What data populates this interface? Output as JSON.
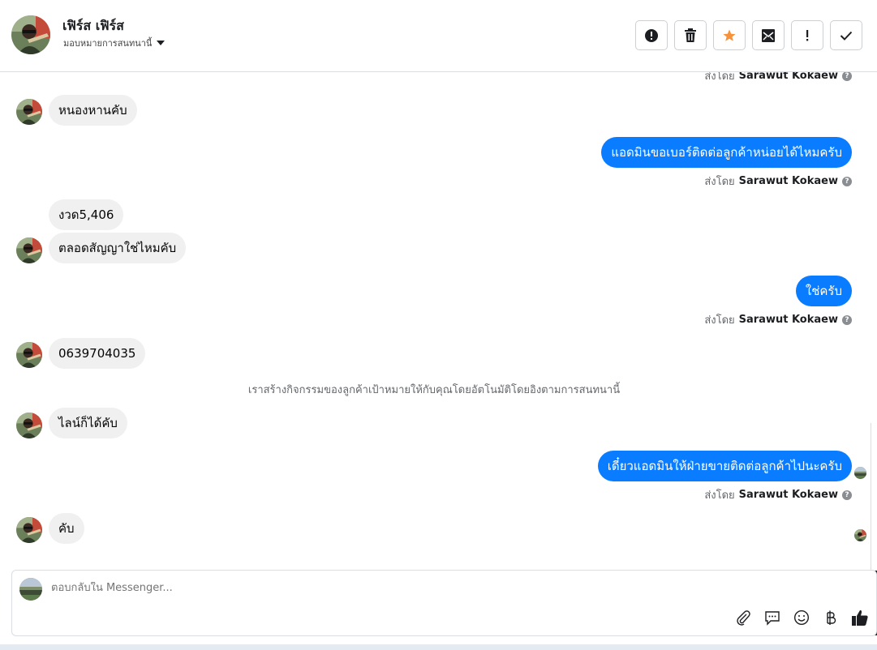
{
  "header": {
    "contact_name": "เฟิร์ส เฟิร์ส",
    "assign_label": "มอบหมายการสนทนานี้"
  },
  "actions": [
    {
      "name": "report-button",
      "icon": "alert-circle-icon"
    },
    {
      "name": "delete-button",
      "icon": "trash-icon"
    },
    {
      "name": "star-button",
      "icon": "star-icon",
      "color": "#f7923b"
    },
    {
      "name": "mark-unread-button",
      "icon": "envelope-icon"
    },
    {
      "name": "important-button",
      "icon": "exclamation-icon"
    },
    {
      "name": "done-button",
      "icon": "check-icon"
    }
  ],
  "messages": {
    "top_sentby": {
      "prefix": "ส่งโดย",
      "sender": "Sarawut Kokaew"
    },
    "m1": "หนองหานคับ",
    "m2": "แอดมินขอเบอร์ติดต่อลูกค้าหน่อยได้ไหมครับ",
    "sentby2": {
      "prefix": "ส่งโดย",
      "sender": "Sarawut Kokaew"
    },
    "m3": "งวด5,406",
    "m4": "ตลอดสัญญาใช่ไหมคับ",
    "m5": "ใช่ครับ",
    "sentby5": {
      "prefix": "ส่งโดย",
      "sender": "Sarawut Kokaew"
    },
    "m6": "0639704035",
    "system": "เราสร้างกิจกรรมของลูกค้าเป้าหมายให้กับคุณโดยอัตโนมัติโดยอิงตามการสนทนานี้",
    "m7": "ไลน์ก็ได้คับ",
    "m8": "เดี๋ยวแอดมินให้ฝ่ายขายติดต่อลูกค้าไปนะครับ",
    "sentby8": {
      "prefix": "ส่งโดย",
      "sender": "Sarawut Kokaew"
    },
    "m9": "คับ"
  },
  "composer": {
    "placeholder": "ตอบกลับใน Messenger..."
  },
  "colors": {
    "outgoing_bubble": "#0a7cff",
    "incoming_bubble": "#f0f0f0",
    "star": "#f7923b"
  }
}
